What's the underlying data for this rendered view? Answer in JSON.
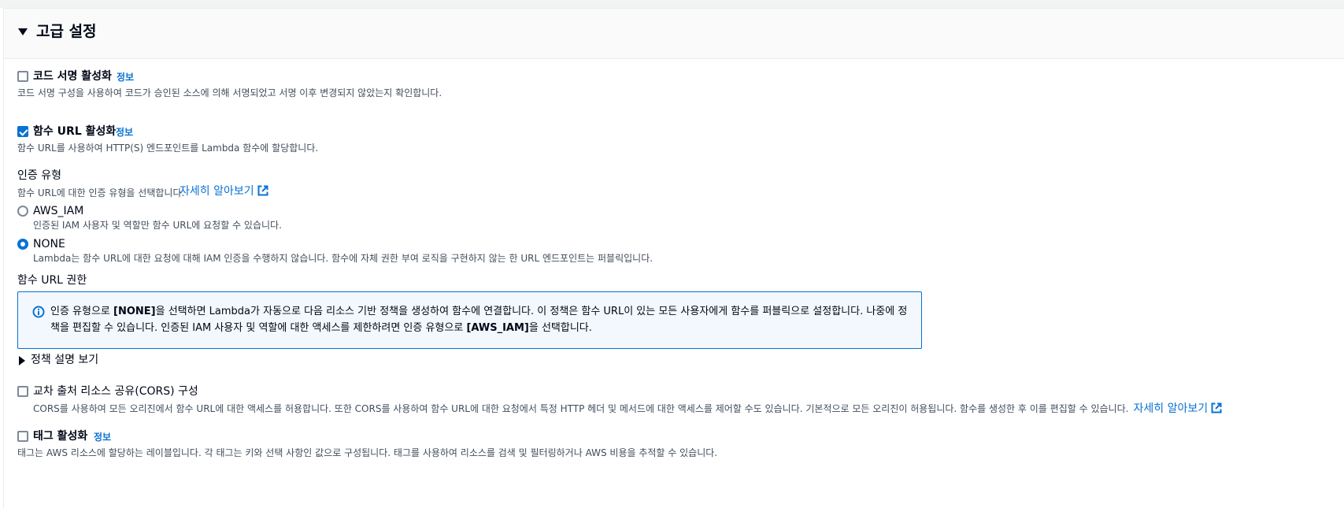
{
  "section": {
    "title": "고급 설정"
  },
  "code_signing": {
    "label": "코드 서명 활성화",
    "info": "정보",
    "description": "코드 서명 구성을 사용하여 코드가 승인된 소스에 의해 서명되었고 서명 이후 변경되지 않았는지 확인합니다.",
    "checked": false
  },
  "function_url": {
    "label": "함수 URL 활성화",
    "info": "정보",
    "description": "함수 URL를 사용하여 HTTP(S) 엔드포인트를 Lambda 함수에 할당합니다.",
    "checked": true
  },
  "auth_type": {
    "title": "인증 유형",
    "description": "함수 URL에 대한 인증 유형을 선택합니다.",
    "learn_more": "자세히 알아보기",
    "options": [
      {
        "label": "AWS_IAM",
        "description": "인증된 IAM 사용자 및 역할만 함수 URL에 요청할 수 있습니다.",
        "selected": false
      },
      {
        "label": "NONE",
        "description": "Lambda는 함수 URL에 대한 요청에 대해 IAM 인증을 수행하지 않습니다. 함수에 자체 권한 부여 로직을 구현하지 않는 한 URL 엔드포인트는 퍼블릭입니다.",
        "selected": true
      }
    ]
  },
  "permissions": {
    "title": "함수 URL 권한",
    "alert": {
      "part1": "인증 유형으로 ",
      "bold1": "[NONE]",
      "part2": "을 선택하면 Lambda가 자동으로 다음 리소스 기반 정책을 생성하여 함수에 연결합니다. 이 정책은 함수 URL이 있는 모든 사용자에게 함수를 퍼블릭으로 설정합니다. 나중에 정책을 편집할 수 있습니다. 인증된 IAM 사용자 및 역할에 대한 액세스를 제한하려면 인증 유형으로 ",
      "bold2": "[AWS_IAM]",
      "part3": "을 선택합니다."
    },
    "expander": "정책 설명 보기"
  },
  "cors": {
    "label": "교차 출처 리소스 공유(CORS) 구성",
    "description": "CORS를 사용하여 모든 오리진에서 함수 URL에 대한 액세스를 허용합니다. 또한 CORS를 사용하여 함수 URL에 대한 요청에서 특정 HTTP 헤더 및 메서드에 대한 액세스를 제어할 수도 있습니다. 기본적으로 모든 오리진이 허용됩니다. 함수를 생성한 후 이를 편집할 수 있습니다.",
    "learn_more": "자세히 알아보기",
    "checked": false
  },
  "tags": {
    "label": "태그 활성화",
    "info": "정보",
    "description": "태그는 AWS 리소스에 할당하는 레이블입니다. 각 태그는 키와 선택 사항인 값으로 구성됩니다. 태그를 사용하여 리소스를 검색 및 필터링하거나 AWS 비용을 추적할 수 있습니다.",
    "checked": false
  },
  "colors": {
    "accent": "#0972d3",
    "text": "#000716",
    "muted": "#414d5c",
    "alert_bg": "#f2f8fd"
  }
}
